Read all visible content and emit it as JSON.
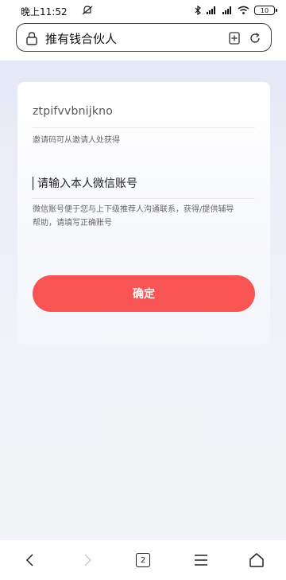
{
  "status_bar": {
    "time": "晚上11:52",
    "battery": "10"
  },
  "url_bar": {
    "title": "推有钱合伙人"
  },
  "form": {
    "invite_code_value": "ztpifvvbnijkno",
    "invite_code_hint": "邀请码可从邀请人处获得",
    "wechat_placeholder": "请输入本人微信账号",
    "wechat_hint": "微信账号便于您与上下级推荐人沟通联系，获得/提供辅导帮助，请填写正确账号",
    "confirm_label": "确定"
  },
  "bottom_nav": {
    "tab_count": "2"
  },
  "colors": {
    "accent": "#f85454",
    "hint_text": "#666666"
  },
  "icons": [
    "mute-icon",
    "bluetooth-icon",
    "signal-icon",
    "wifi-icon",
    "battery-icon",
    "lock-icon",
    "bookmark-add-icon",
    "refresh-icon",
    "back-icon",
    "forward-icon",
    "tabs-icon",
    "menu-icon",
    "home-icon"
  ]
}
